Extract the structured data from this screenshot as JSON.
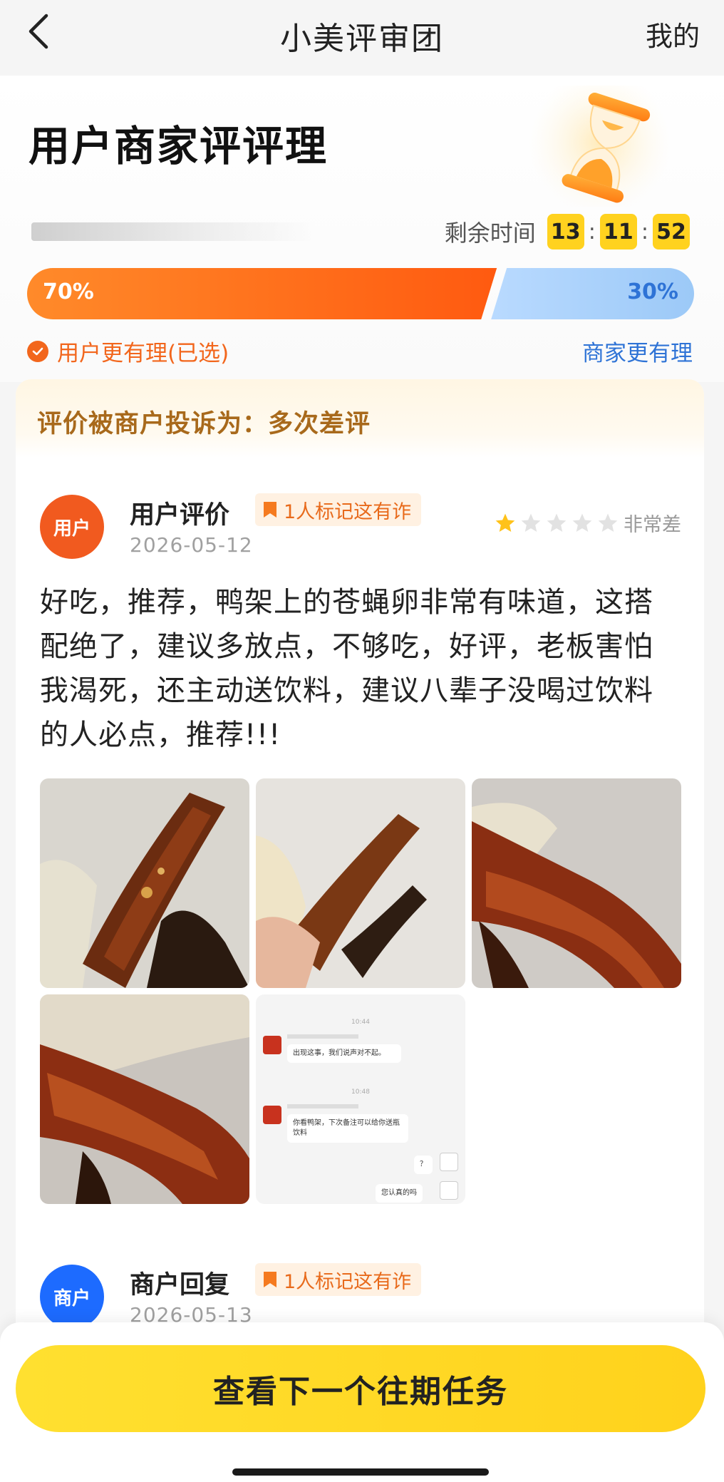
{
  "nav": {
    "title": "小美评审团",
    "right_label": "我的"
  },
  "header": {
    "title": "用户商家评评理",
    "countdown_label": "剩余时间",
    "hours": "13",
    "minutes": "11",
    "seconds": "52",
    "separator": ":"
  },
  "vote": {
    "user_pct_label": "70%",
    "merchant_pct_label": "30%",
    "user_fraction": 0.7,
    "merchant_fraction": 0.3,
    "user_choice_label": "用户更有理(已选)",
    "merchant_choice_label": "商家更有理",
    "colors": {
      "user": "#ff6a1a",
      "merchant": "#a9cffa"
    }
  },
  "card": {
    "complaint": "评价被商户投诉为：多次差评",
    "user_review": {
      "avatar_label": "用户",
      "author": "用户评价",
      "fraud_tag": "1人标记这有诈",
      "date": "2026-05-12",
      "stars": 1,
      "rating_text": "非常差",
      "text": "好吃，推荐，鸭架上的苍蝇卵非常有味道，这搭配绝了，建议多放点，不够吃，好评，老板害怕我渴死，还主动送饮料，建议八辈子没喝过饮料的人必点，推荐!!!"
    },
    "chat_screenshot": {
      "time1": "10:44",
      "bubble1": "出现这事，我们说声对不起。",
      "time2": "10:48",
      "bubble2": "你看鸭架，下次备注可以给你送瓶饮料",
      "bubble3": "？",
      "bubble4": "您认真的吗"
    },
    "merchant_reply": {
      "avatar_label": "商户",
      "author": "商户回复",
      "fraud_tag": "1人标记这有诈",
      "date": "2026-05-13"
    }
  },
  "bottom": {
    "next_button": "查看下一个往期任务"
  }
}
